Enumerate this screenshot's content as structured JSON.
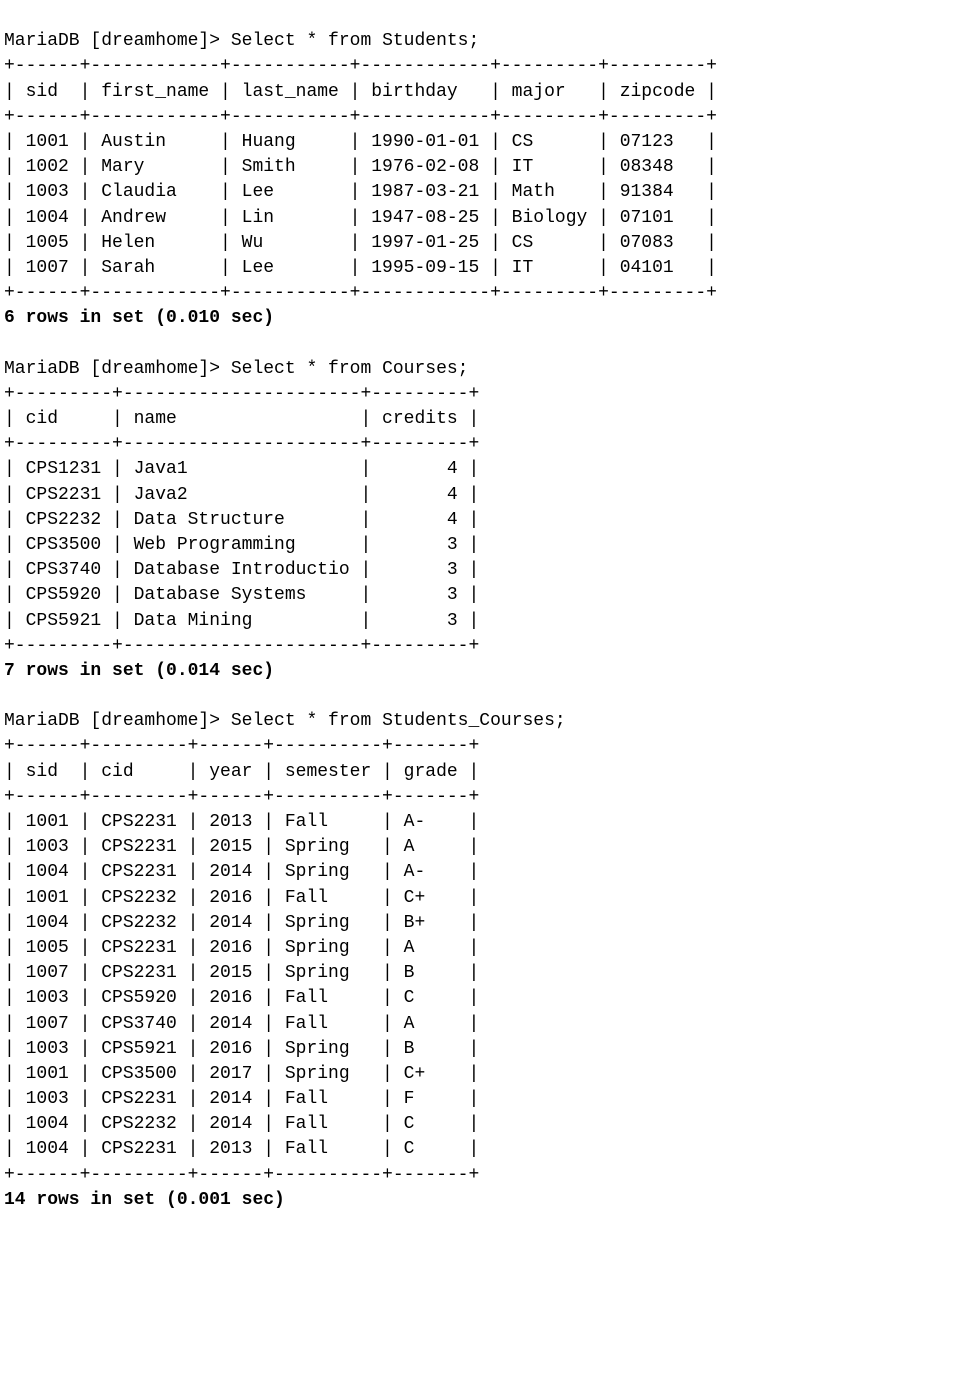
{
  "prompt_prefix": "MariaDB [dreamhome]> ",
  "queries": [
    {
      "sql": "Select * from Students;",
      "timing": "6 rows in set (0.010 sec)",
      "columns": [
        "sid",
        "first_name",
        "last_name",
        "birthday",
        "major",
        "zipcode"
      ],
      "widths": [
        6,
        12,
        11,
        12,
        9,
        9
      ],
      "align": [
        "l",
        "l",
        "l",
        "l",
        "l",
        "l"
      ],
      "rows": [
        [
          "1001",
          "Austin",
          "Huang",
          "1990-01-01",
          "CS",
          "07123"
        ],
        [
          "1002",
          "Mary",
          "Smith",
          "1976-02-08",
          "IT",
          "08348"
        ],
        [
          "1003",
          "Claudia",
          "Lee",
          "1987-03-21",
          "Math",
          "91384"
        ],
        [
          "1004",
          "Andrew",
          "Lin",
          "1947-08-25",
          "Biology",
          "07101"
        ],
        [
          "1005",
          "Helen",
          "Wu",
          "1997-01-25",
          "CS",
          "07083"
        ],
        [
          "1007",
          "Sarah",
          "Lee",
          "1995-09-15",
          "IT",
          "04101"
        ]
      ]
    },
    {
      "sql": "Select * from Courses;",
      "timing": "7 rows in set (0.014 sec)",
      "columns": [
        "cid",
        "name",
        "credits"
      ],
      "widths": [
        9,
        22,
        9
      ],
      "align": [
        "l",
        "l",
        "r"
      ],
      "rows": [
        [
          "CPS1231",
          "Java1",
          "4"
        ],
        [
          "CPS2231",
          "Java2",
          "4"
        ],
        [
          "CPS2232",
          "Data Structure",
          "4"
        ],
        [
          "CPS3500",
          "Web Programming",
          "3"
        ],
        [
          "CPS3740",
          "Database Introductio",
          "3"
        ],
        [
          "CPS5920",
          "Database Systems",
          "3"
        ],
        [
          "CPS5921",
          "Data Mining",
          "3"
        ]
      ]
    },
    {
      "sql": "Select * from Students_Courses;",
      "timing": "14 rows in set (0.001 sec)",
      "columns": [
        "sid",
        "cid",
        "year",
        "semester",
        "grade"
      ],
      "widths": [
        6,
        9,
        6,
        10,
        7
      ],
      "align": [
        "l",
        "l",
        "l",
        "l",
        "l"
      ],
      "rows": [
        [
          "1001",
          "CPS2231",
          "2013",
          "Fall",
          "A-"
        ],
        [
          "1003",
          "CPS2231",
          "2015",
          "Spring",
          "A"
        ],
        [
          "1004",
          "CPS2231",
          "2014",
          "Spring",
          "A-"
        ],
        [
          "1001",
          "CPS2232",
          "2016",
          "Fall",
          "C+"
        ],
        [
          "1004",
          "CPS2232",
          "2014",
          "Spring",
          "B+"
        ],
        [
          "1005",
          "CPS2231",
          "2016",
          "Spring",
          "A"
        ],
        [
          "1007",
          "CPS2231",
          "2015",
          "Spring",
          "B"
        ],
        [
          "1003",
          "CPS5920",
          "2016",
          "Fall",
          "C"
        ],
        [
          "1007",
          "CPS3740",
          "2014",
          "Fall",
          "A"
        ],
        [
          "1003",
          "CPS5921",
          "2016",
          "Spring",
          "B"
        ],
        [
          "1001",
          "CPS3500",
          "2017",
          "Spring",
          "C+"
        ],
        [
          "1003",
          "CPS2231",
          "2014",
          "Fall",
          "F"
        ],
        [
          "1004",
          "CPS2232",
          "2014",
          "Fall",
          "C"
        ],
        [
          "1004",
          "CPS2231",
          "2013",
          "Fall",
          "C"
        ]
      ]
    }
  ]
}
